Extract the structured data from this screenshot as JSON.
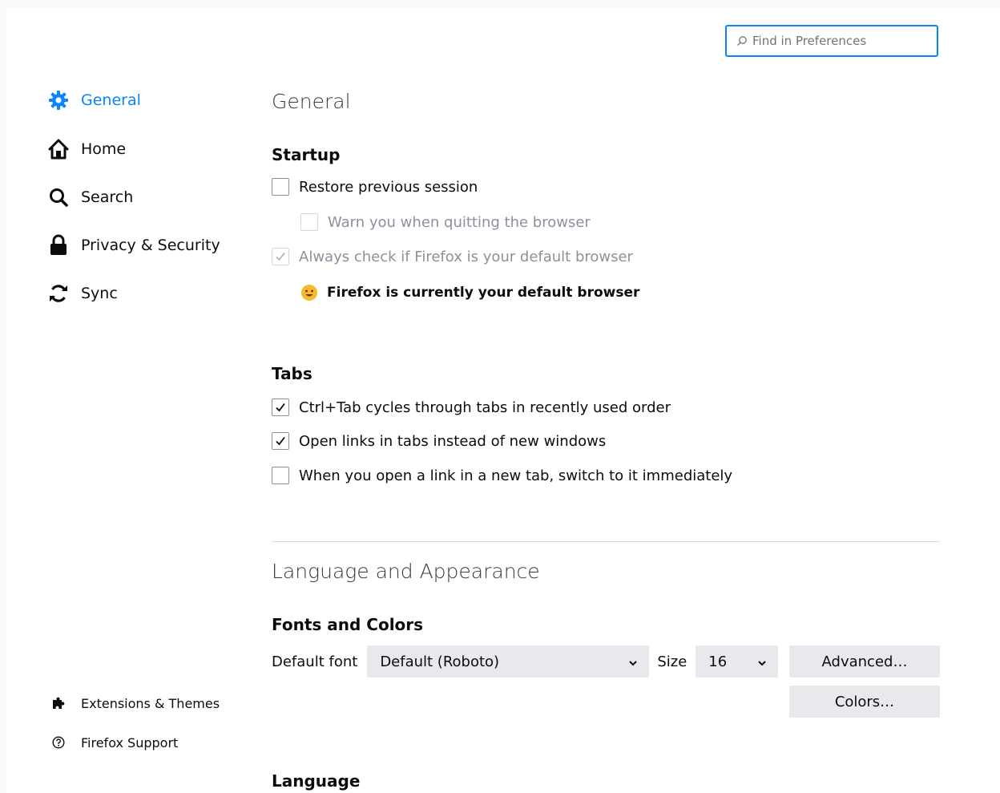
{
  "search": {
    "placeholder": "Find in Preferences",
    "icon": "search-icon"
  },
  "sidebar": {
    "items": [
      {
        "label": "General",
        "icon": "gear-icon",
        "selected": true
      },
      {
        "label": "Home",
        "icon": "home-icon"
      },
      {
        "label": "Search",
        "icon": "magnifier-icon"
      },
      {
        "label": "Privacy & Security",
        "icon": "lock-icon"
      },
      {
        "label": "Sync",
        "icon": "sync-icon"
      }
    ],
    "footer": [
      {
        "label": "Extensions & Themes",
        "icon": "puzzle-icon"
      },
      {
        "label": "Firefox Support",
        "icon": "help-icon"
      }
    ]
  },
  "general": {
    "title": "General",
    "startup": {
      "heading": "Startup",
      "restore_session": {
        "label": "Restore previous session",
        "checked": false
      },
      "warn_quit": {
        "label": "Warn you when quitting the browser",
        "checked": false,
        "disabled": true
      },
      "default_check": {
        "label": "Always check if Firefox is your default browser",
        "checked": true,
        "disabled": true
      },
      "default_status": "Firefox is currently your default browser"
    },
    "tabs": {
      "heading": "Tabs",
      "ctrl_tab": {
        "label": "Ctrl+Tab cycles through tabs in recently used order",
        "checked": true
      },
      "open_links": {
        "label": "Open links in tabs instead of new windows",
        "checked": true
      },
      "switch_tab": {
        "label": "When you open a link in a new tab, switch to it immediately",
        "checked": false
      }
    }
  },
  "appearance": {
    "title": "Language and Appearance",
    "fonts": {
      "heading": "Fonts and Colors",
      "default_font_label": "Default font",
      "default_font_value": "Default (Roboto)",
      "size_label": "Size",
      "size_value": "16",
      "advanced_button": "Advanced…",
      "colors_button": "Colors…"
    },
    "language_heading": "Language"
  },
  "colors": {
    "accent": "#0a84ff",
    "text": "#0c0c0d",
    "disabled_text": "#8f8f9d",
    "button_bg": "#e9e9ed"
  }
}
